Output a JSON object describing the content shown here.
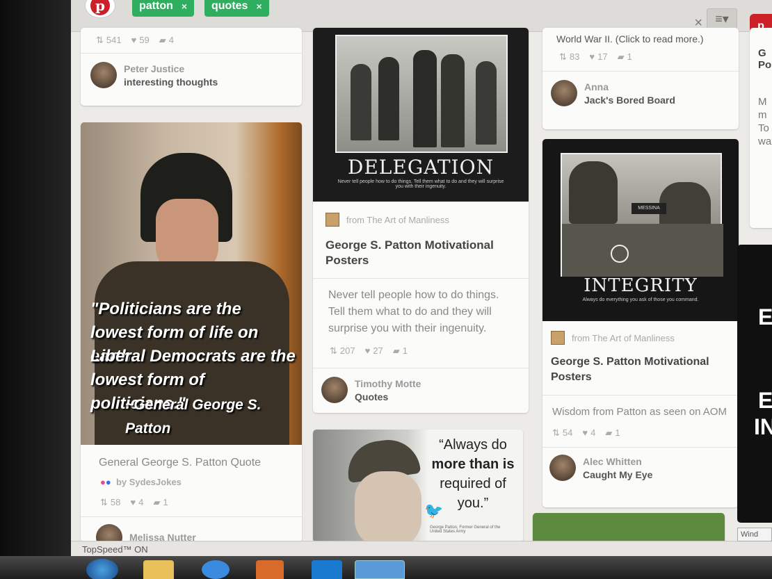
{
  "topbar": {
    "tags": [
      {
        "label": "patton",
        "remove": "×"
      },
      {
        "label": "quotes",
        "remove": "×"
      }
    ],
    "clear": "×",
    "menu_icon": "≡▾",
    "pin_logo": "p"
  },
  "col1": {
    "top_card": {
      "repins": "541",
      "likes": "59",
      "comments": "4",
      "pinner_name": "Peter Justice",
      "board": "interesting thoughts"
    },
    "quote_card": {
      "quote_lines": [
        "\"Politicians are the",
        "lowest form of life on earth.",
        "Liberal Democrats are the",
        "lowest form of politicians.\"",
        "~General George S. Patton"
      ],
      "description": "General George S. Patton Quote",
      "via": "by SydesJokes",
      "repins": "58",
      "likes": "4",
      "comments": "1",
      "pinner_name": "Melissa Nutter"
    }
  },
  "col2": {
    "delegation_card": {
      "poster_title": "DELEGATION",
      "poster_caption": "Never tell people how to do things. Tell them what to do and they will surprise you with their ingenuity.",
      "source": "from The Art of Manliness",
      "title": "George S. Patton Motivational Posters",
      "description": "Never tell people how to do things. Tell them what to do and they will surprise you with their ingenuity.",
      "repins": "207",
      "likes": "27",
      "comments": "1",
      "pinner_name": "Timothy Motte",
      "board": "Quotes"
    },
    "always_card": {
      "quote_lines": [
        "“Always do",
        "more than is",
        "required of",
        "you.”"
      ],
      "attribution": "George Patton, Former General of the United States Army"
    }
  },
  "col3": {
    "top_card": {
      "partial_text": "World War II. (Click to read more.)",
      "repins": "83",
      "likes": "17",
      "comments": "1",
      "pinner_name": "Anna",
      "board": "Jack's Bored Board"
    },
    "integrity_card": {
      "sign_text": "MESSINA",
      "poster_title": "INTEGRITY",
      "poster_caption": "Always do everything you ask of those you command.",
      "source": "from The Art of Manliness",
      "title": "George S. Patton Motivational Posters",
      "description": "Wisdom from Patton as seen on AOM",
      "repins": "54",
      "likes": "4",
      "comments": "1",
      "pinner_name": "Alec Whitten",
      "board": "Caught My Eye"
    }
  },
  "col4": {
    "partial_lines": [
      "G",
      "Po",
      "M",
      "m",
      "To",
      "wa"
    ],
    "dark_card_lines": [
      "E",
      "E",
      "IN"
    ]
  },
  "statusbar": {
    "text": "TopSpeed™ ON",
    "right_text": "Wind"
  },
  "colors": {
    "pinterest_red": "#cb2027",
    "tag_green": "#2fae5f"
  }
}
